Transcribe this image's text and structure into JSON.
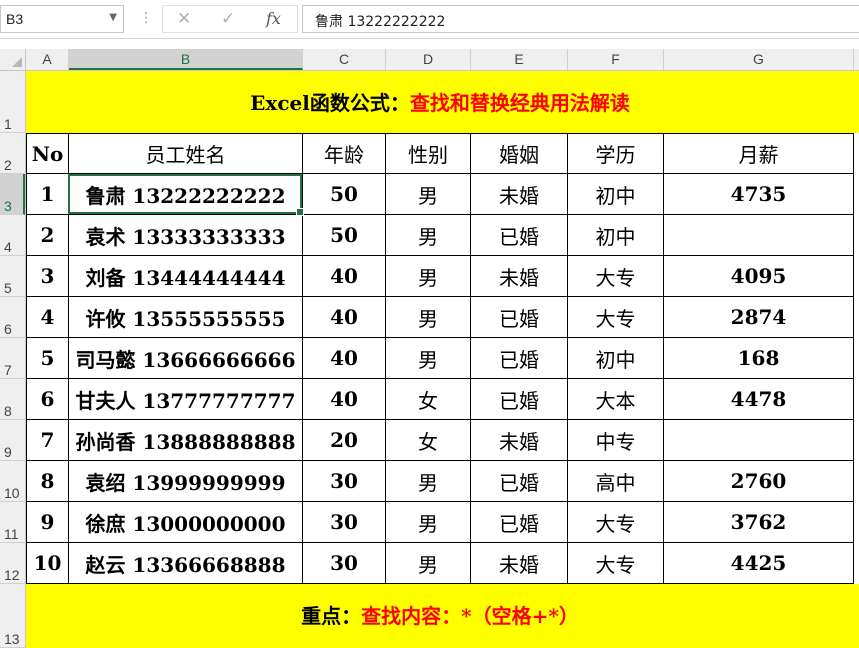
{
  "formula_bar": {
    "name_box": "B3",
    "formula": "鲁肃 13222222222",
    "cancel_icon": "✕",
    "enter_icon": "✓",
    "fx_icon": "fx"
  },
  "columns": [
    "A",
    "B",
    "C",
    "D",
    "E",
    "F",
    "G"
  ],
  "rows": [
    "1",
    "2",
    "3",
    "4",
    "5",
    "6",
    "7",
    "8",
    "9",
    "10",
    "11",
    "12",
    "13"
  ],
  "title": {
    "black": "Excel函数公式：",
    "red": "查找和替换经典用法解读"
  },
  "headers": [
    "No",
    "员工姓名",
    "年龄",
    "性别",
    "婚姻",
    "学历",
    "月薪"
  ],
  "records": [
    [
      "1",
      "鲁肃 13222222222",
      "50",
      "男",
      "未婚",
      "初中",
      "4735"
    ],
    [
      "2",
      "袁术 13333333333",
      "50",
      "男",
      "已婚",
      "初中",
      ""
    ],
    [
      "3",
      "刘备 13444444444",
      "40",
      "男",
      "未婚",
      "大专",
      "4095"
    ],
    [
      "4",
      "许攸 13555555555",
      "40",
      "男",
      "已婚",
      "大专",
      "2874"
    ],
    [
      "5",
      "司马懿 13666666666",
      "40",
      "男",
      "已婚",
      "初中",
      "168"
    ],
    [
      "6",
      "甘夫人 13777777777",
      "40",
      "女",
      "已婚",
      "大本",
      "4478"
    ],
    [
      "7",
      "孙尚香 13888888888",
      "20",
      "女",
      "未婚",
      "中专",
      ""
    ],
    [
      "8",
      "袁绍 13999999999",
      "30",
      "男",
      "已婚",
      "高中",
      "2760"
    ],
    [
      "9",
      "徐庶 13000000000",
      "30",
      "男",
      "已婚",
      "大专",
      "3762"
    ],
    [
      "10",
      "赵云 13366668888",
      "30",
      "男",
      "未婚",
      "大专",
      "4425"
    ]
  ],
  "footer": {
    "black": "重点：",
    "red": "查找内容：*（空格+*）"
  },
  "colors": {
    "band_yellow": "#ffff00",
    "accent_red": "#ff0000",
    "selection_green": "#217346"
  }
}
